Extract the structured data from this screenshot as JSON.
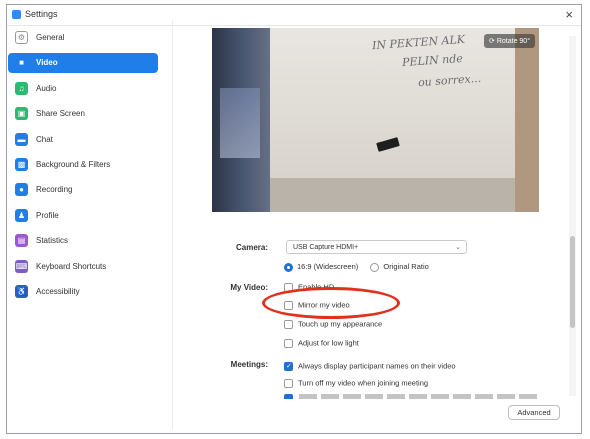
{
  "window": {
    "title": "Settings",
    "close_symbol": "×"
  },
  "sidebar": {
    "items": [
      {
        "label": "General",
        "icon": "gear-icon",
        "color": "#ffffff",
        "active": false
      },
      {
        "label": "Video",
        "icon": "video-camera-icon",
        "color": "#1f7ee8",
        "active": true
      },
      {
        "label": "Audio",
        "icon": "headphones-icon",
        "color": "#2eb872",
        "active": false
      },
      {
        "label": "Share Screen",
        "icon": "share-screen-icon",
        "color": "#2eb872",
        "active": false
      },
      {
        "label": "Chat",
        "icon": "chat-bubble-icon",
        "color": "#1f7ee8",
        "active": false
      },
      {
        "label": "Background & Filters",
        "icon": "background-icon",
        "color": "#1f7ee8",
        "active": false
      },
      {
        "label": "Recording",
        "icon": "record-icon",
        "color": "#1f7ee8",
        "active": false
      },
      {
        "label": "Profile",
        "icon": "person-icon",
        "color": "#1f7ee8",
        "active": false
      },
      {
        "label": "Statistics",
        "icon": "statistics-icon",
        "color": "#9b59d0",
        "active": false
      },
      {
        "label": "Keyboard Shortcuts",
        "icon": "keyboard-icon",
        "color": "#7b5cc9",
        "active": false
      },
      {
        "label": "Accessibility",
        "icon": "accessibility-icon",
        "color": "#2d5fb8",
        "active": false
      }
    ]
  },
  "preview": {
    "rotate_label": "Rotate 90°",
    "board_text": [
      "IN PEKTEN ALK",
      "PELIN nde",
      "ou sorrex..."
    ]
  },
  "camera": {
    "label": "Camera:",
    "selected": "USB Capture HDMI+"
  },
  "ratio": {
    "option1": "16:9 (Widescreen)",
    "option2": "Original Ratio",
    "selected": "16:9 (Widescreen)"
  },
  "my_video": {
    "label": "My Video:",
    "options": [
      {
        "label": "Enable HD",
        "checked": false
      },
      {
        "label": "Mirror my video",
        "checked": false
      },
      {
        "label": "Touch up my appearance",
        "checked": false
      },
      {
        "label": "Adjust for low light",
        "checked": false
      }
    ]
  },
  "meetings": {
    "label": "Meetings:",
    "options": [
      {
        "label": "Always display participant names on their video",
        "checked": true
      },
      {
        "label": "Turn off my video when joining meeting",
        "checked": false
      }
    ]
  },
  "advanced_button": "Advanced",
  "colors": {
    "accent": "#1f7ee8",
    "highlight_ellipse": "#e0301e"
  }
}
